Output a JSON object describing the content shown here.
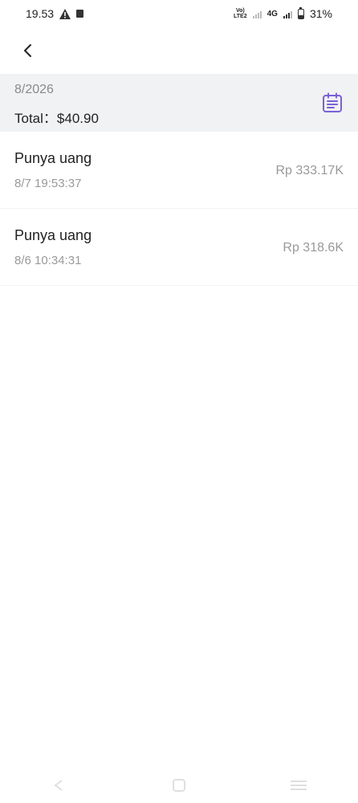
{
  "status_bar": {
    "time": "19.53",
    "volte_top": "Vo)",
    "volte_bottom": "LTE2",
    "network": "4G",
    "battery": "31%"
  },
  "header": {
    "month": "8/2026",
    "total": "Total：$40.90"
  },
  "records": [
    {
      "title": "Punya uang",
      "time": "8/7 19:53:37",
      "amount": "Rp 333.17K"
    },
    {
      "title": "Punya uang",
      "time": "8/6 10:34:31",
      "amount": "Rp 318.6K"
    }
  ],
  "colors": {
    "accent": "#7b61d6",
    "header_bg": "#f1f2f4"
  },
  "icons": {
    "back": "chevron-left-icon",
    "calendar": "calendar-list-icon"
  }
}
